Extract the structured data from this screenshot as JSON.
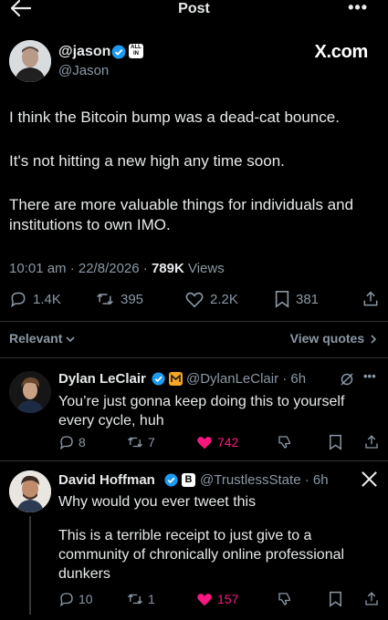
{
  "header": {
    "title": "Post",
    "more_label": "•••"
  },
  "author": {
    "name": "@jason",
    "handle": "@Jason",
    "badge_text": "ALL IN",
    "brand": "X.com"
  },
  "post": {
    "paragraphs": [
      "I think the Bitcoin bump was a dead-cat bounce.",
      "It's not hitting a new high any time soon.",
      "There are more valuable things for individuals and institutions to own IMO."
    ],
    "time": "10:01 am · 22/8/2026 · ",
    "views_count": "789K",
    "views_label": " Views",
    "replies": "1.4K",
    "reposts": "395",
    "likes": "2.2K",
    "bookmarks": "381"
  },
  "filter": {
    "sort_label": "Relevant",
    "view_quotes": "View quotes"
  },
  "replies": [
    {
      "name": "Dylan LeClair",
      "handle": "@DylanLeClair · 6h",
      "text": "You’re just gonna keep doing this to yourself every cycle, huh",
      "replies": "8",
      "reposts": "7",
      "likes": "742"
    },
    {
      "name": "David Hoffman",
      "badge_letter": "B",
      "handle": "@TrustlessState · 6h",
      "text1": "Why would you ever tweet this",
      "text2": "This is a terrible receipt to just give to a community of chronically online professional dunkers",
      "replies": "10",
      "reposts": "1",
      "likes": "157"
    }
  ],
  "colors": {
    "background": "#000000",
    "verified": "#1d9bf0",
    "like": "#f91880",
    "muted": "#8b98a5",
    "text": "#e7e9ea"
  }
}
